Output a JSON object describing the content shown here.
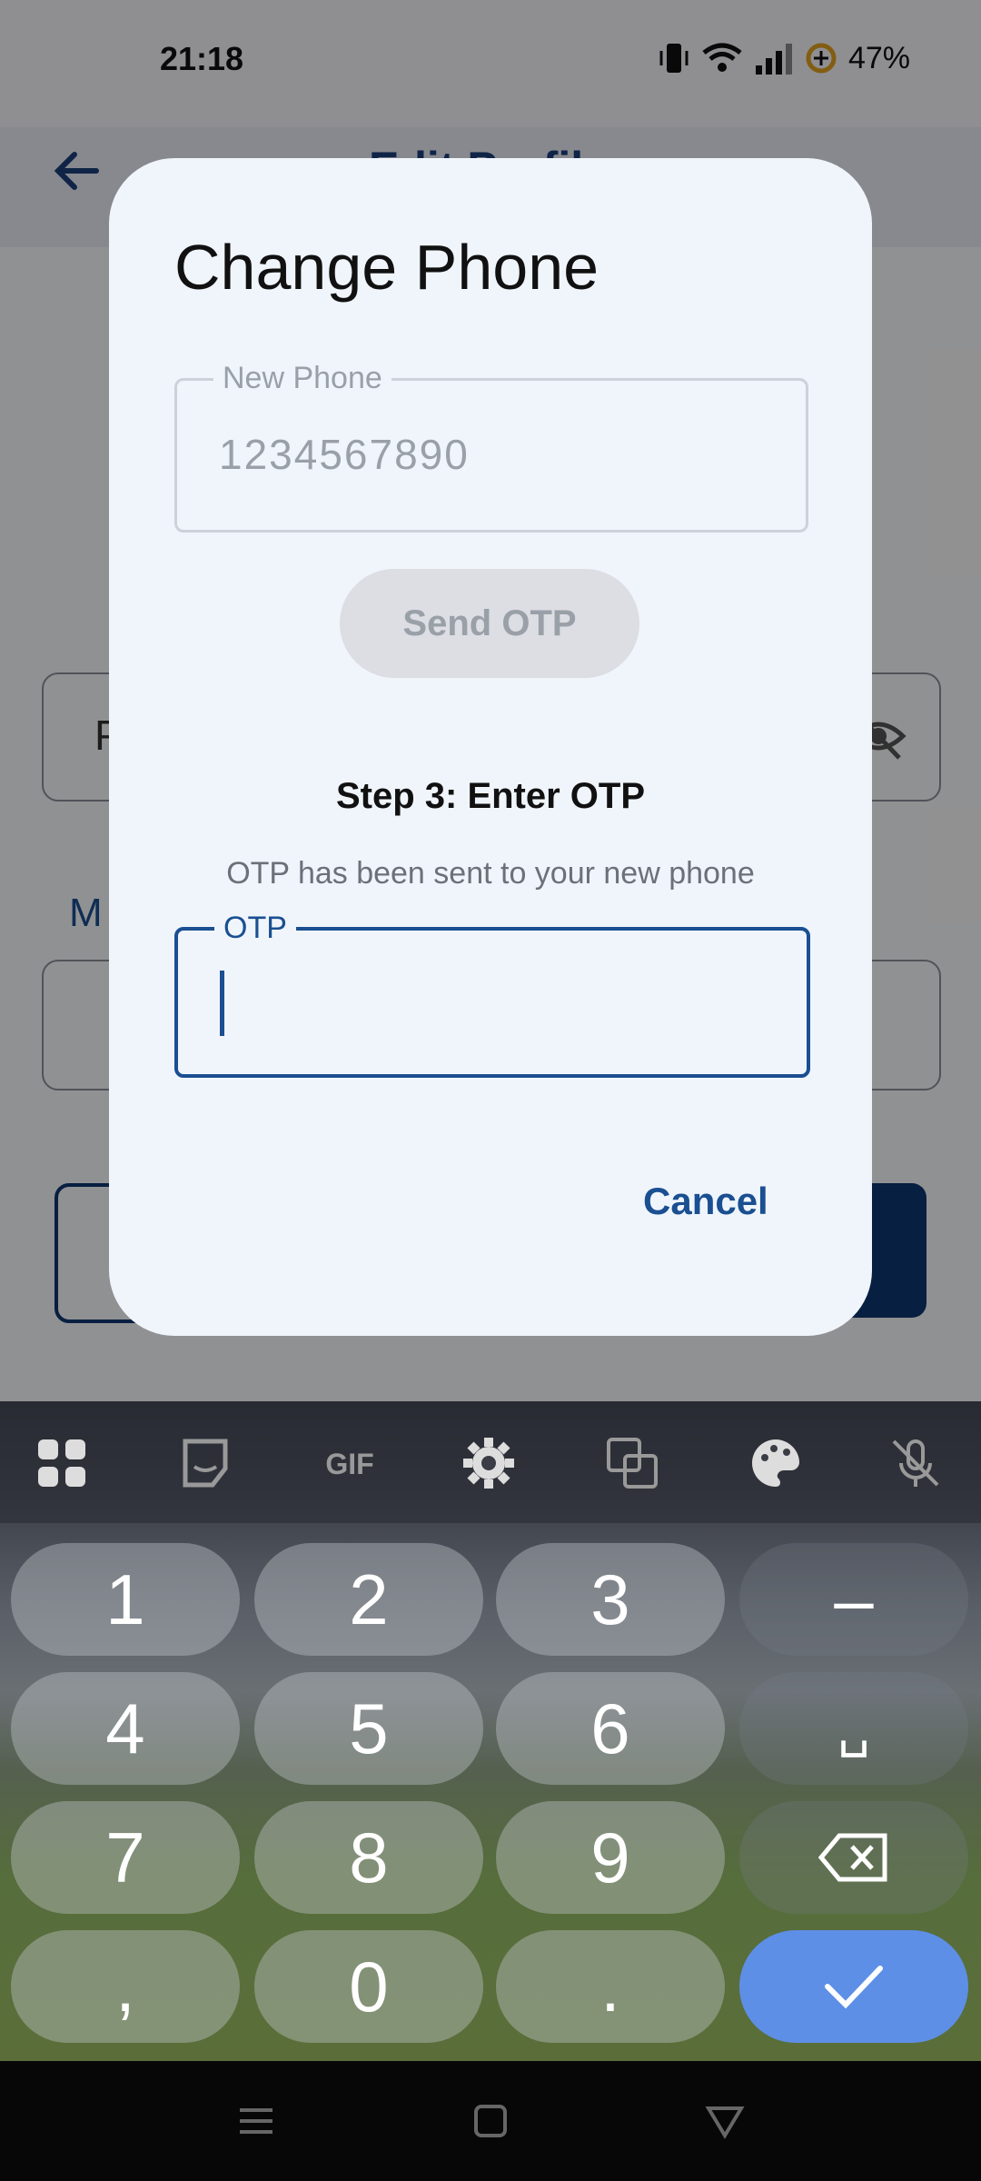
{
  "status_bar": {
    "time": "21:18",
    "battery": "47%"
  },
  "app_bar": {
    "title": "Edit Profile"
  },
  "background": {
    "field_label_m": "M",
    "field_prefix": "P"
  },
  "dialog": {
    "title": "Change Phone",
    "phone_field": {
      "label": "New Phone",
      "value": "1234567890"
    },
    "send_otp_label": "Send OTP",
    "step_title": "Step 3: Enter OTP",
    "step_subtitle": "OTP has been sent to your new phone",
    "otp_field": {
      "label": "OTP",
      "value": ""
    },
    "cancel_label": "Cancel"
  },
  "keyboard": {
    "toolbar": [
      "apps-icon",
      "sticker-icon",
      "gif-icon",
      "settings-icon",
      "translate-icon",
      "palette-icon",
      "mic-off-icon"
    ],
    "gif_label": "GIF",
    "keys": {
      "k1": "1",
      "k2": "2",
      "k3": "3",
      "dash": "–",
      "k4": "4",
      "k5": "5",
      "k6": "6",
      "space": "␣",
      "k7": "7",
      "k8": "8",
      "k9": "9",
      "comma": ",",
      "k0": "0",
      "period": "."
    }
  },
  "colors": {
    "accent": "#1a4f91",
    "enter_key": "#5e8fe6",
    "dialog_bg": "#f0f5fc"
  }
}
